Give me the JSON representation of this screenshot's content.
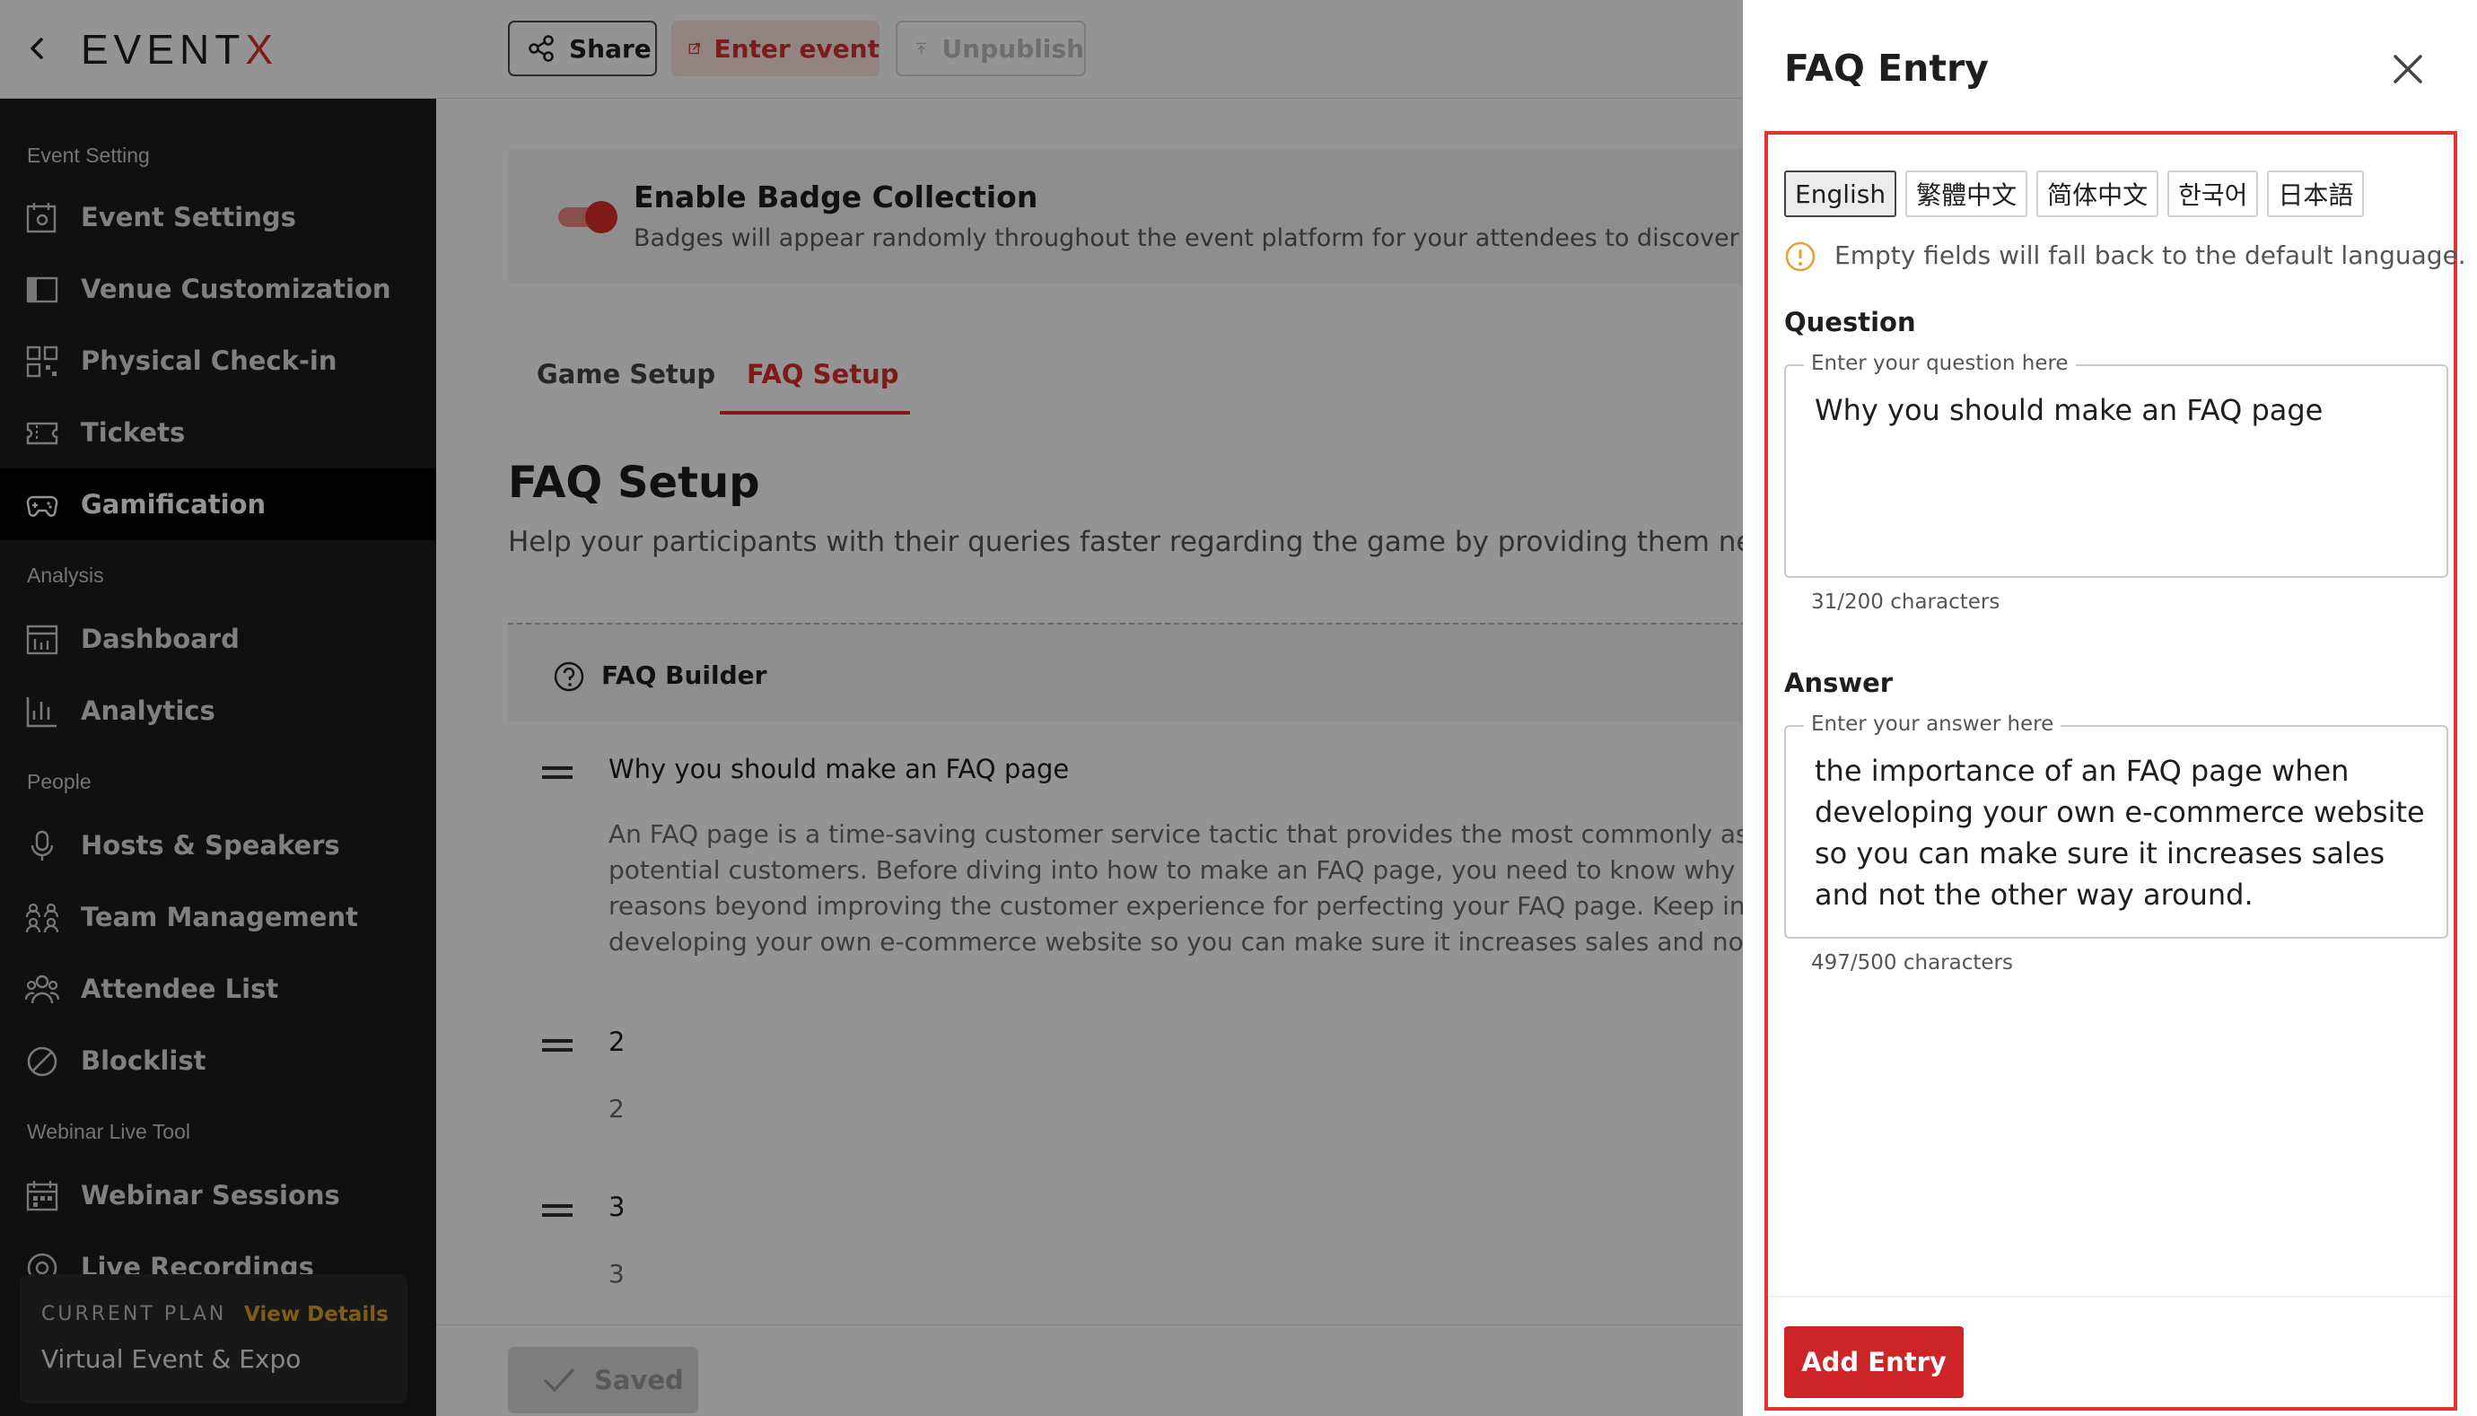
{
  "app": {
    "logo_main": "EVENT",
    "logo_x": "X"
  },
  "toolbar": {
    "share": "Share",
    "enter_event": "Enter event",
    "unpublish": "Unpublish"
  },
  "sidebar": {
    "sections": [
      "Event Setting",
      "Analysis",
      "People",
      "Webinar Live Tool"
    ],
    "items": [
      {
        "label": "Event Settings",
        "icon": "calendar-gear-icon"
      },
      {
        "label": "Venue Customization",
        "icon": "layout-icon"
      },
      {
        "label": "Physical Check-in",
        "icon": "qr-code-icon"
      },
      {
        "label": "Tickets",
        "icon": "ticket-icon"
      },
      {
        "label": "Gamification",
        "icon": "gamepad-icon",
        "active": true
      },
      {
        "label": "Dashboard",
        "icon": "dashboard-icon"
      },
      {
        "label": "Analytics",
        "icon": "bar-chart-icon"
      },
      {
        "label": "Hosts & Speakers",
        "icon": "microphone-icon"
      },
      {
        "label": "Team Management",
        "icon": "team-icon"
      },
      {
        "label": "Attendee List",
        "icon": "users-icon"
      },
      {
        "label": "Blocklist",
        "icon": "block-icon"
      },
      {
        "label": "Webinar Sessions",
        "icon": "calendar-icon"
      },
      {
        "label": "Live Recordings",
        "icon": "record-icon"
      }
    ],
    "plan": {
      "tag": "CURRENT PLAN",
      "view": "View Details",
      "name": "Virtual Event & Expo"
    }
  },
  "main": {
    "badge": {
      "title": "Enable Badge Collection",
      "desc": "Badges will appear randomly throughout the event platform for your attendees to discover",
      "enabled": true
    },
    "tabs": [
      "Game Setup",
      "FAQ Setup"
    ],
    "active_tab": "FAQ Setup",
    "faq_title": "FAQ Setup",
    "faq_sub": "Help your participants with their queries faster regarding the game by providing them neces",
    "builder_label": "FAQ Builder",
    "faqs": [
      {
        "q": "Why you should make an FAQ page",
        "a": [
          "An FAQ page is a time-saving customer service tactic that provides the most commonly asked q",
          "potential customers. Before diving into how to make an FAQ page, you need to know why having",
          "reasons beyond improving the customer experience for perfecting your FAQ page. Keep in mind",
          "developing your own e-commerce website so you can make sure it increases sales and not the o"
        ]
      },
      {
        "q": "2",
        "a": [
          "2"
        ]
      },
      {
        "q": "3",
        "a": [
          "3"
        ]
      }
    ],
    "saved": "Saved"
  },
  "drawer": {
    "title": "FAQ Entry",
    "languages": [
      "English",
      "繁體中文",
      "简体中文",
      "한국어",
      "日本語"
    ],
    "selected_language": "English",
    "info": "Empty fields will fall back to the default language.",
    "question": {
      "label": "Question",
      "placeholder": "Enter your question here",
      "value": "Why you should make an FAQ page",
      "count": "31/200 characters"
    },
    "answer": {
      "label": "Answer",
      "placeholder": "Enter your answer here",
      "value": "the importance of an FAQ page when developing your own e-commerce website so you can make sure it increases sales and not the other way around.",
      "count": "497/500 characters"
    },
    "add": "Add Entry"
  },
  "colors": {
    "accent": "#d9302a",
    "sidebar_bg": "#1d1d1d",
    "button_red": "#cd2428",
    "plan_link": "#d9a227"
  }
}
